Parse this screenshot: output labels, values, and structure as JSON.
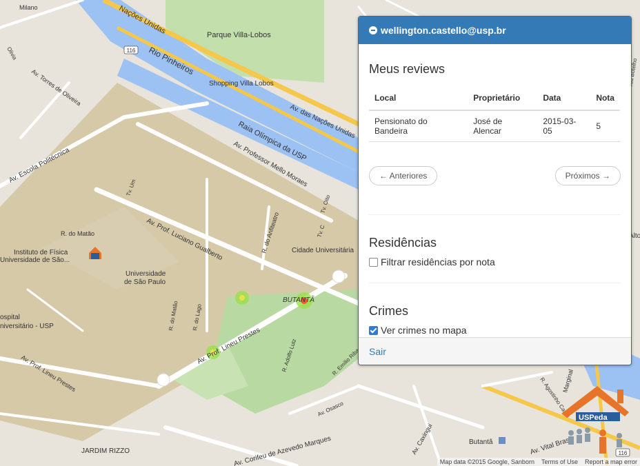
{
  "map": {
    "labels": {
      "nacoes_unidas_top": "Nações Unidas",
      "parque": "Parque Villa-Lobos",
      "rio": "Rio Pinheiros",
      "shopping": "Shopping Villa Lobos",
      "nacoes_unidas": "Av. das Nações Unidas",
      "raia": "Raia Olímpica da USP",
      "mello_moraes": "Av. Professor Mello Moraes",
      "politecnica": "Av. Escola Politécnica",
      "torres": "Av. Torres de Oliveira",
      "tv_um": "Tv. Um",
      "gualberto": "Av. Prof. Luciano Gualberto",
      "matao": "R. do Matão",
      "fisica1": "Instituto de Física",
      "fisica2": "Universidade de São...",
      "usp1": "Universidade",
      "usp2": "de São Paulo",
      "anfiteatro": "R. do Anfiteatro",
      "cidade_univ": "Cidade Universitária",
      "tv_c": "Tv. C",
      "tv_oito": "Tv. Oito",
      "butanta_label": "BUTANTÃ",
      "hospital1": "ospital",
      "hospital2": "niversitário - USP",
      "lineu1": "Av. Prof. Lineu Prestes",
      "lineu2": "Av. Prof. Lineu Prestes",
      "rlago": "R. do Lago",
      "rmatao2": "R. do Matão",
      "adolfo": "R. Adolfo Lutz",
      "emilio": "R. Emílio Ribas",
      "osasco": "Av. Osasco",
      "jardim": "JARDIM RIZZO",
      "marques": "Av. Corifeu de Azevedo Marques",
      "caxingui": "Av. Caxingui",
      "vital": "Av. Vital Brasil",
      "butanta_station": "Butantã",
      "agostinho": "R. Agostinho Cantu",
      "marginal": "Marginal",
      "milano": "Milano",
      "olivia": "Olivia",
      "arruda": "Av. Arruda Botelho",
      "alto": "Alto",
      "road_116a": "116",
      "road_116b": "116"
    },
    "attribution": {
      "data": "Map data ©2015 Google, Sanborn",
      "terms": "Terms of Use",
      "report": "Report a map error"
    },
    "logo_text": "USPeda"
  },
  "panel": {
    "user_email": "wellington.castello@usp.br",
    "reviews": {
      "heading": "Meus reviews",
      "columns": [
        "Local",
        "Proprietário",
        "Data",
        "Nota"
      ],
      "rows": [
        [
          "Pensionato do Bandeira",
          "José de Alencar",
          "2015-03-05",
          "5"
        ]
      ],
      "prev_label": "← Anteriores",
      "next_label": "Próximos →"
    },
    "residencias": {
      "heading": "Residências",
      "filter_label": "Filtrar residências por nota",
      "filter_checked": false
    },
    "crimes": {
      "heading": "Crimes",
      "show_label": "Ver crimes no mapa",
      "show_checked": true
    },
    "logout_label": "Sair"
  }
}
